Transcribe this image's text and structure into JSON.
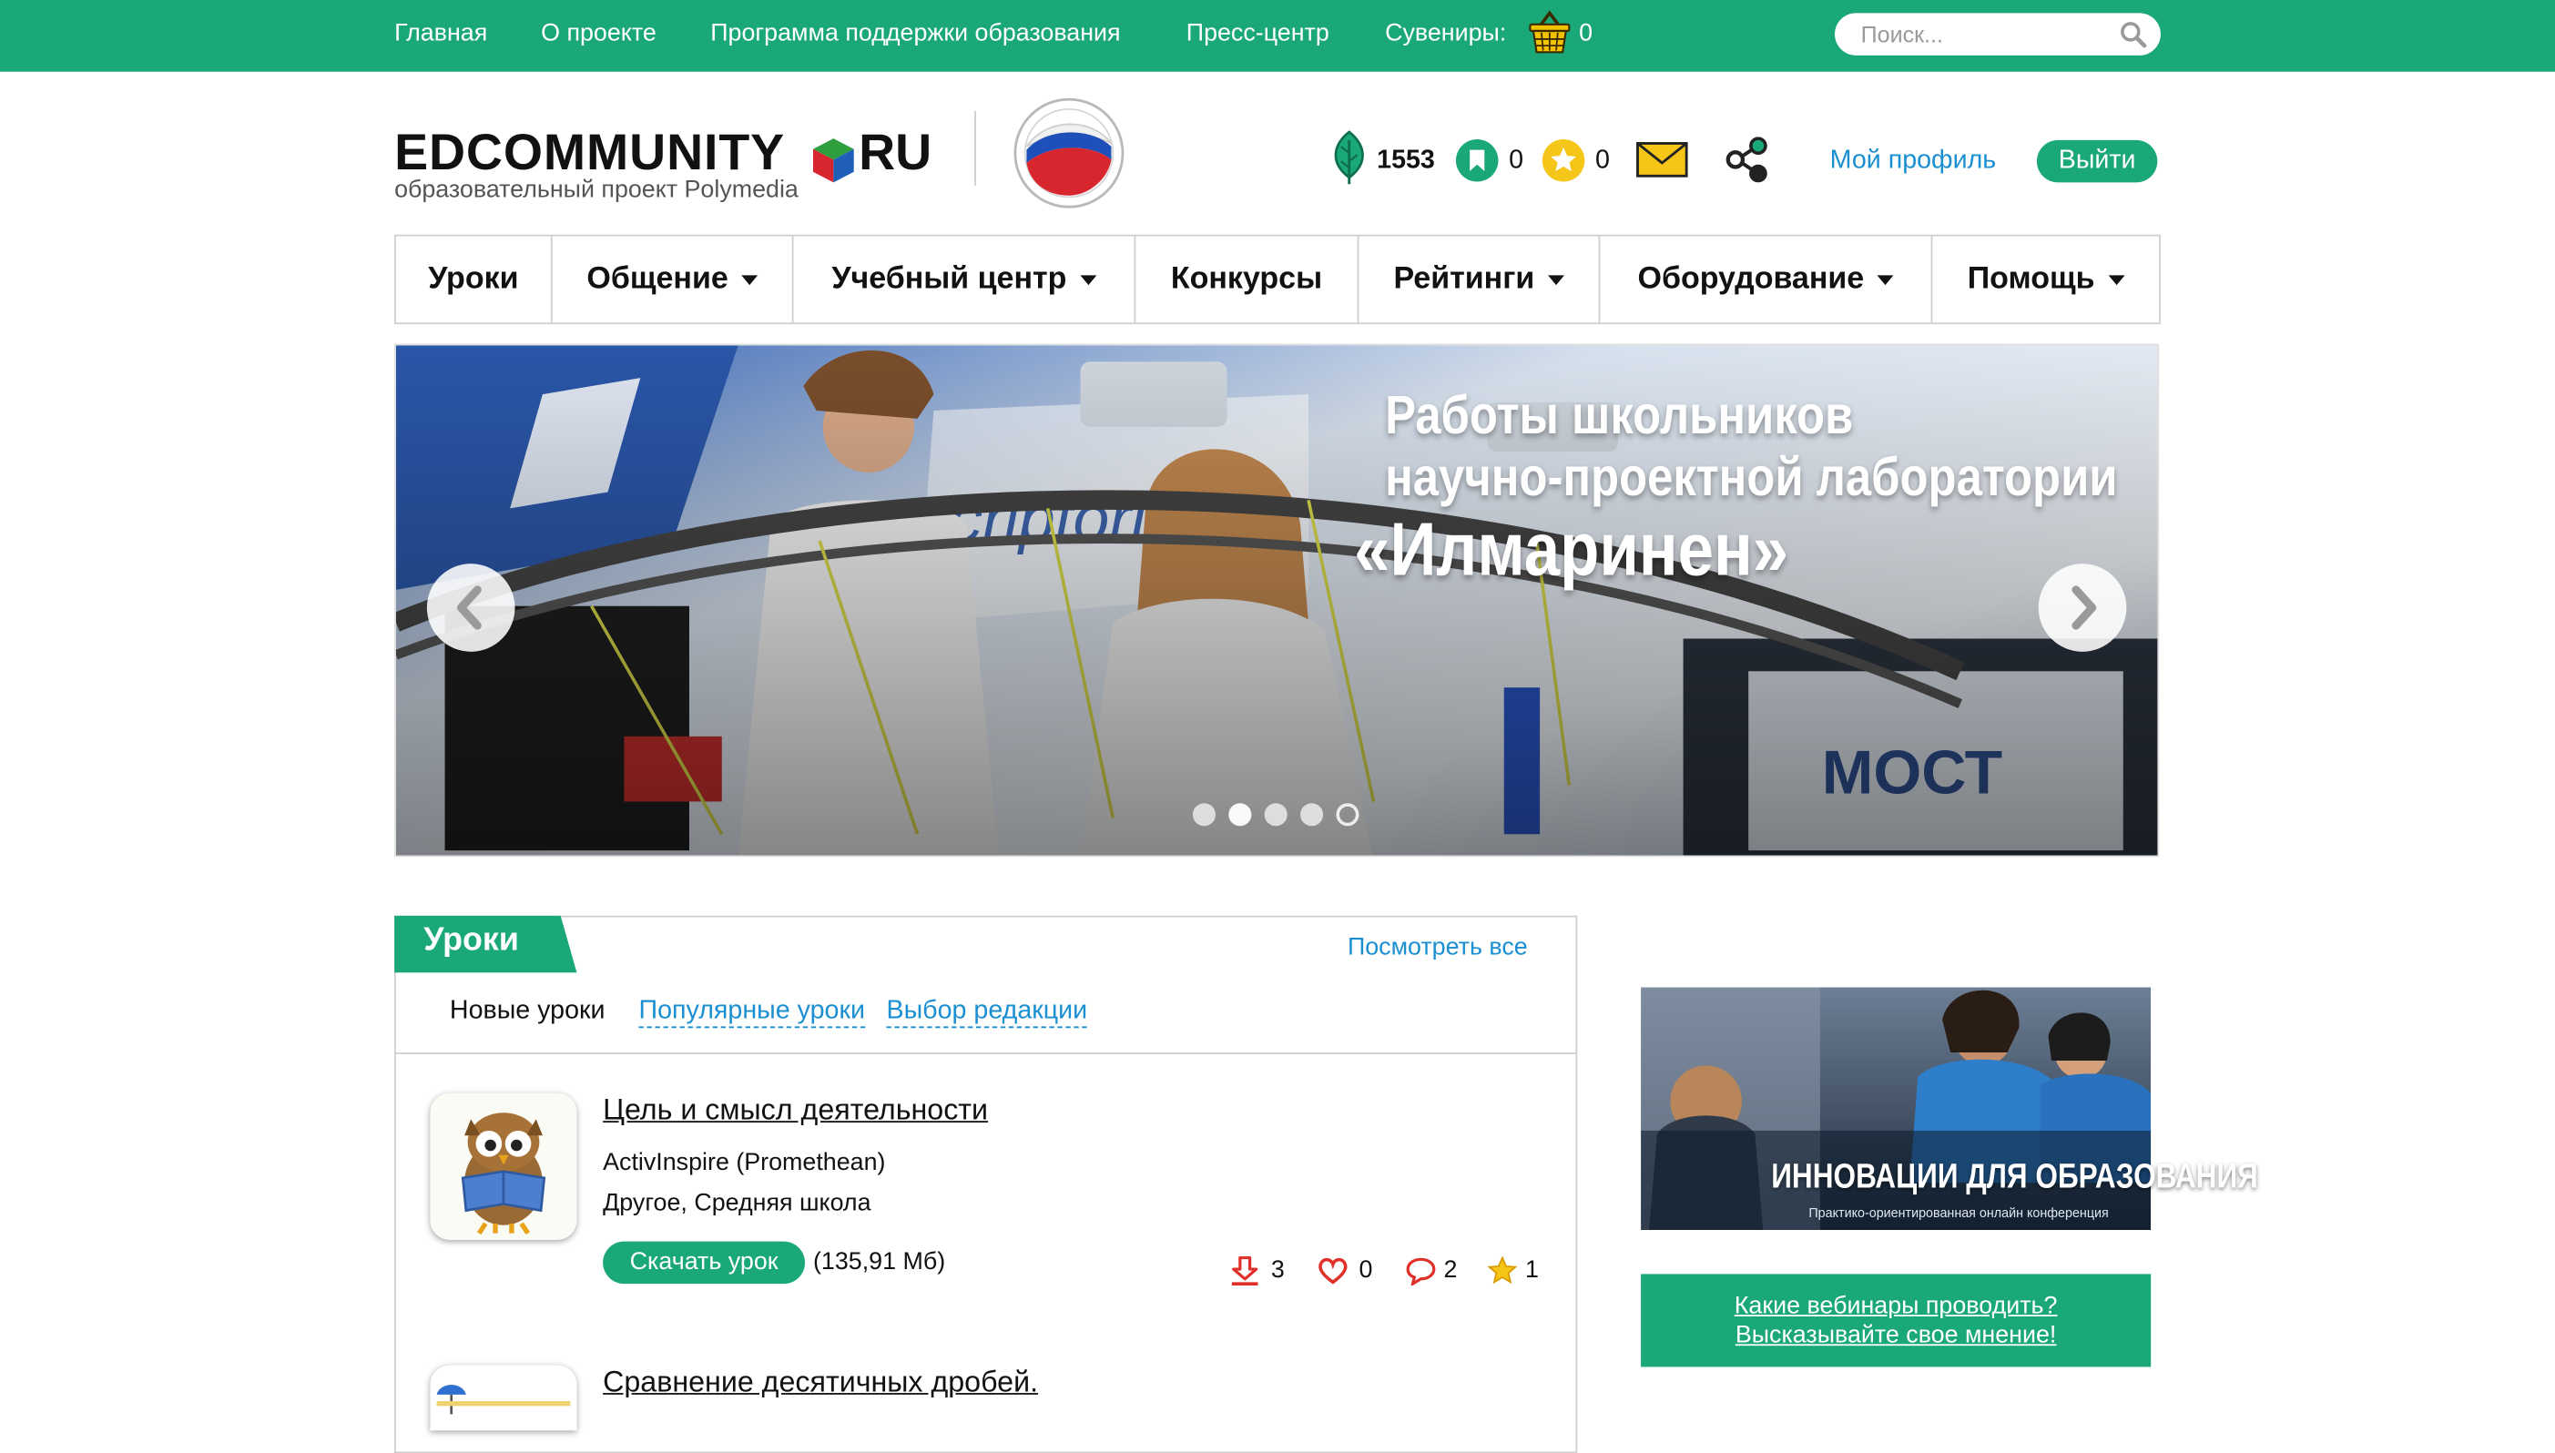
{
  "topnav": {
    "items": [
      "Главная",
      "О проекте",
      "Программа поддержки образования",
      "Пресс-центр",
      "Сувениры:"
    ],
    "basket_count": "0",
    "search_placeholder": "Поиск..."
  },
  "header": {
    "logo_text": "EDCOMMUNITY",
    "logo_suffix": "RU",
    "logo_sub": "образовательный проект Polymedia",
    "emblem_icon": "social-projects-emblem",
    "stats": {
      "leaves": "1553",
      "bookmarks": "0",
      "stars": "0"
    },
    "profile_link": "Мой профиль",
    "logout": "Выйти"
  },
  "mainnav": {
    "items": [
      {
        "label": "Уроки",
        "dropdown": false
      },
      {
        "label": "Общение",
        "dropdown": true
      },
      {
        "label": "Учебный центр",
        "dropdown": true
      },
      {
        "label": "Конкурсы",
        "dropdown": false
      },
      {
        "label": "Рейтинги",
        "dropdown": true
      },
      {
        "label": "Оборудование",
        "dropdown": true
      },
      {
        "label": "Помощь",
        "dropdown": true
      }
    ]
  },
  "banner": {
    "lines": [
      "Работы школьников",
      "научно-проектной лаборатории",
      "«Илмаринен»"
    ],
    "wall_text": "МОСТ",
    "dots": 5
  },
  "lessons": {
    "title": "Уроки",
    "view_all": "Посмотреть все",
    "tabs": [
      "Новые уроки",
      "Популярные уроки",
      "Выбор редакции"
    ],
    "items": [
      {
        "title": "Цель и смысл деятельности",
        "software": "ActivInspire (Promethean)",
        "category": "Другое, Средняя школа",
        "download": "Скачать урок",
        "size": "(135,91 Мб)",
        "downloads": "3",
        "likes": "0",
        "comments": "2",
        "rating": "1"
      },
      {
        "title": "Сравнение десятичных дробей."
      }
    ]
  },
  "sidebar": {
    "ad_title": "ИННОВАЦИИ ДЛЯ ОБРАЗОВАНИЯ",
    "ad_sub": "Практико-ориентированная онлайн конференция",
    "webinar_lines": [
      "Какие вебинары проводить?",
      "Высказывайте свое мнение!"
    ]
  },
  "colors": {
    "brand_green": "#1ba879",
    "link_blue": "#1a8fd1",
    "star_yellow": "#f5c518",
    "alert_red": "#e0302a"
  }
}
